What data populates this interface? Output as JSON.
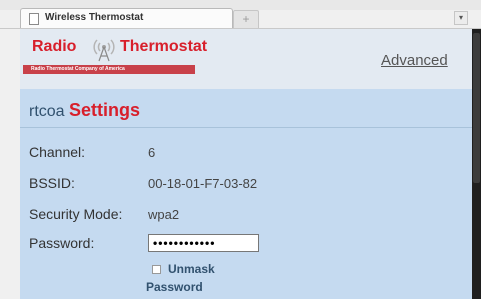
{
  "browser": {
    "tab_title": "Wireless Thermostat",
    "new_tab_symbol": "+",
    "tab_menu_symbol": "▾"
  },
  "header": {
    "logo_word_1": "Radio",
    "logo_word_2": "Thermostat",
    "logo_tagline": "Radio Thermostat Company of America",
    "advanced_link": "Advanced"
  },
  "settings": {
    "device_name": "rtcoa",
    "title": "Settings",
    "rows": [
      {
        "label": "Channel:",
        "value": "6"
      },
      {
        "label": "BSSID:",
        "value": "00-18-01-F7-03-82"
      },
      {
        "label": "Security Mode:",
        "value": "wpa2"
      }
    ],
    "password_label": "Password:",
    "password_value": "••••••••••••",
    "unmask_line1": "Unmask",
    "unmask_line2": "Password"
  },
  "colors": {
    "brand_red": "#d81f2b",
    "page_bg": "#c5daf0",
    "header_bg": "#e3eaf2"
  }
}
